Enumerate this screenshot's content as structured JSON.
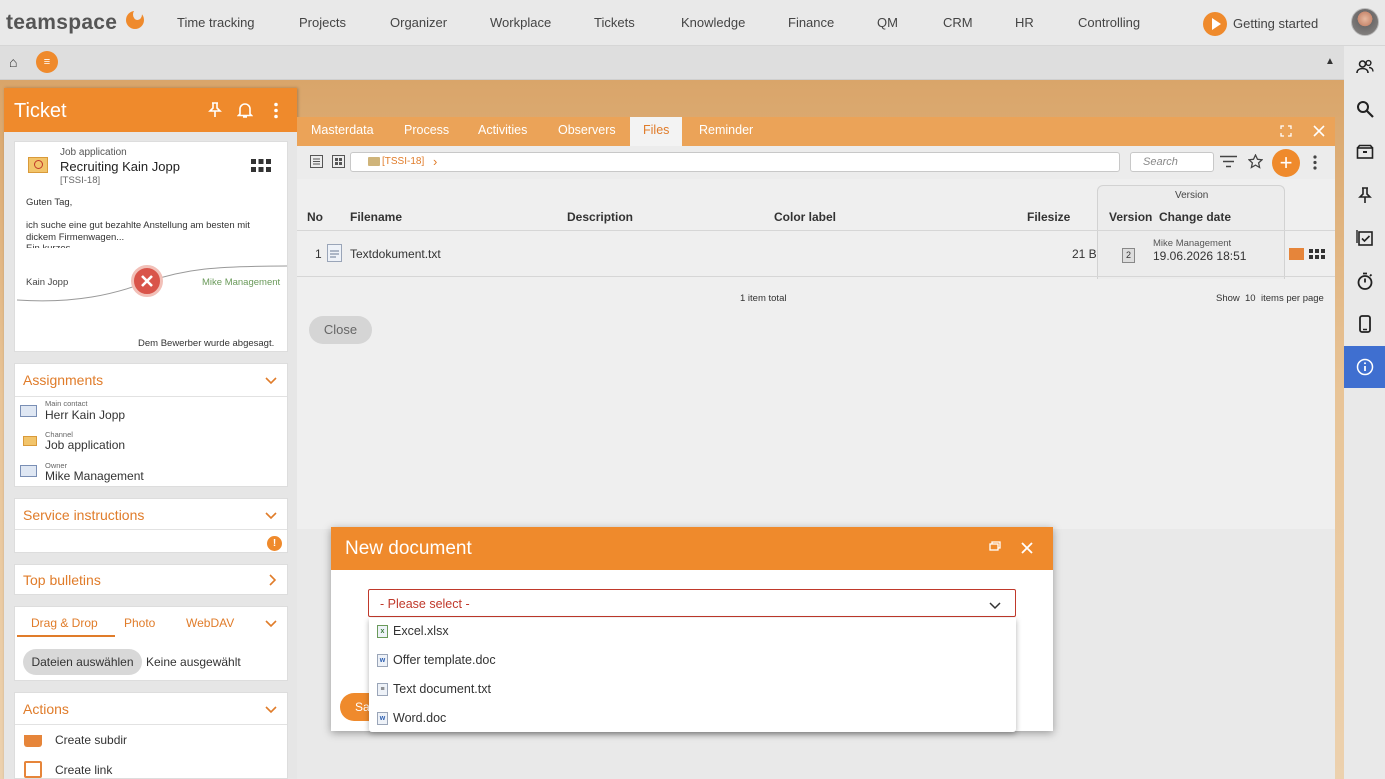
{
  "app": {
    "logo": "teamspace"
  },
  "topnav": {
    "items": [
      "Time tracking",
      "Projects",
      "Organizer",
      "Workplace",
      "Tickets",
      "Knowledge",
      "Finance",
      "QM",
      "CRM",
      "HR",
      "Controlling"
    ],
    "getting_started": "Getting started"
  },
  "subbar": {
    "menu_glyph": "≡"
  },
  "ticket": {
    "panel_title": "Ticket",
    "category": "Job application",
    "name": "Recruiting Kain Jopp",
    "id": "[TSSI-18]",
    "greeting": "Guten Tag,",
    "message": "ich suche eine gut bezahlte Anstellung am besten mit dickem Firmenwagen...",
    "message_cut": "Ein kurzes",
    "from": "Kain Jopp",
    "to": "Mike Management",
    "status_text": "Dem Bewerber wurde abgesagt."
  },
  "assignments": {
    "title": "Assignments",
    "items": [
      {
        "label": "Main contact",
        "value": "Herr Kain Jopp",
        "icon": "contact-card-icon"
      },
      {
        "label": "Channel",
        "value": "Job application",
        "icon": "channel-icon"
      },
      {
        "label": "Owner",
        "value": "Mike Management",
        "icon": "owner-icon"
      }
    ]
  },
  "service_instructions": {
    "title": "Service instructions",
    "badge": "!"
  },
  "top_bulletins": {
    "title": "Top bulletins"
  },
  "upload": {
    "tabs": [
      "Drag & Drop",
      "Photo",
      "WebDAV"
    ],
    "choose_button": "Dateien auswählen",
    "no_file": "Keine ausgewählt"
  },
  "actions": {
    "title": "Actions",
    "items": [
      "Create subdir",
      "Create link"
    ]
  },
  "tabs": [
    "Masterdata",
    "Process",
    "Activities",
    "Observers",
    "Files",
    "Reminder"
  ],
  "active_tab": "Files",
  "files": {
    "breadcrumb": "[TSSI-18]",
    "search_placeholder": "Search",
    "columns": {
      "no": "No",
      "filename": "Filename",
      "description": "Description",
      "color_label": "Color label",
      "filesize": "Filesize",
      "version_group": "Version",
      "version": "Version",
      "change_date": "Change date"
    },
    "rows": [
      {
        "no": "1",
        "filename": "Textdokument.txt",
        "description": "",
        "color_label": "",
        "filesize": "21 B",
        "version": "2",
        "user": "Mike Management",
        "date": "19.06.2026 18:51"
      }
    ],
    "total": "1 item total",
    "show_label": "Show",
    "per_page_value": "10",
    "per_page_suffix": "items per page",
    "close_button": "Close"
  },
  "dialog": {
    "title": "New document",
    "select_placeholder": "- Please select -",
    "options": [
      {
        "label": "Excel.xlsx",
        "icon": "excel-file-icon"
      },
      {
        "label": "Offer template.doc",
        "icon": "word-file-icon"
      },
      {
        "label": "Text document.txt",
        "icon": "text-file-icon"
      },
      {
        "label": "Word.doc",
        "icon": "word-file-icon"
      }
    ],
    "save_button_fragment": "Sa"
  },
  "colors": {
    "accent": "#ef8a2c",
    "tab_bar": "#eba358",
    "active_sidebar": "#3f6fd0",
    "error": "#c0392b",
    "muted_green": "#6a9a5a"
  }
}
